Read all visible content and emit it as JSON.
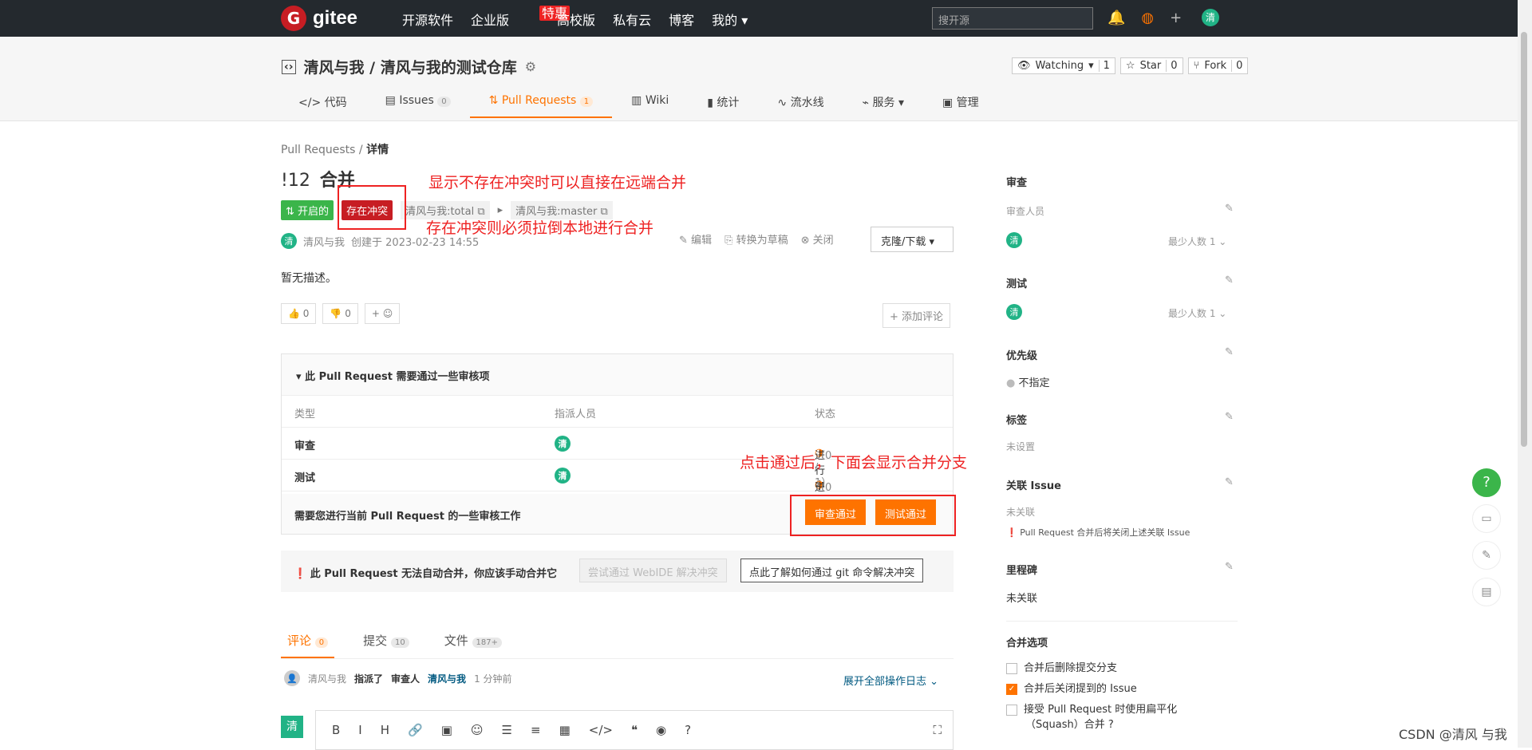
{
  "nav": {
    "logo": "gitee",
    "items": [
      "开源软件",
      "企业版",
      "高校版",
      "私有云",
      "博客",
      "我的"
    ],
    "hot": "特惠",
    "search_placeholder": "搜开源",
    "user_avatar": "清"
  },
  "repo": {
    "title": "清风与我 / 清风与我的测试仓库",
    "watching": "Watching",
    "watch_count": "1",
    "star": "Star",
    "star_count": "0",
    "fork": "Fork",
    "fork_count": "0",
    "tabs": [
      {
        "label": "代码"
      },
      {
        "label": "Issues",
        "count": "0"
      },
      {
        "label": "Pull Requests",
        "count": "1"
      },
      {
        "label": "Wiki"
      },
      {
        "label": "统计"
      },
      {
        "label": "流水线"
      },
      {
        "label": "服务"
      },
      {
        "label": "管理"
      }
    ]
  },
  "pr": {
    "breadcrumb_root": "Pull Requests",
    "breadcrumb_sep": "/",
    "breadcrumb_cur": "详情",
    "number": "!12",
    "title": "合并",
    "status": "开启的",
    "conflict": "存在冲突",
    "source": "清风与我:total",
    "target": "清风与我:master",
    "author": "清风与我",
    "created": "创建于 2023-02-23 14:55",
    "actions": [
      "编辑",
      "转换为草稿",
      "关闭"
    ],
    "clone": "克隆/下载",
    "description": "暂无描述。",
    "thumbs_up": "0",
    "thumbs_down": "0",
    "add_react": "+ ☺",
    "add_comment": "+ 添加评论"
  },
  "review": {
    "header": "此 Pull Request 需要通过一些审核项",
    "cols": [
      "类型",
      "指派人员",
      "状态"
    ],
    "rows": [
      {
        "type": "审查",
        "assignee": "清",
        "status": "进行中",
        "progress": "（0 / 1）"
      },
      {
        "type": "测试",
        "assignee": "清",
        "status": "进行中",
        "progress": "（0 / 1）"
      }
    ],
    "footer": "需要您进行当前 Pull Request 的一些审核工作",
    "btn_review": "审查通过",
    "btn_test": "测试通过"
  },
  "warn": {
    "text": "此 Pull Request 无法自动合并，你应该手动合并它",
    "btn_webide": "尝试通过 WebIDE 解决冲突",
    "btn_git": "点此了解如何通过 git 命令解决冲突"
  },
  "ctabs": [
    {
      "label": "评论",
      "count": "0"
    },
    {
      "label": "提交",
      "count": "10"
    },
    {
      "label": "文件",
      "count": "187+"
    }
  ],
  "log": {
    "user": "清风与我",
    "action": "指派了",
    "role": "审查人",
    "target": "清风与我",
    "time": "1 分钟前",
    "expand": "展开全部操作日志"
  },
  "editor": {
    "avatar": "清",
    "tools": [
      "B",
      "I",
      "H",
      "🔗",
      "▣",
      "☺",
      "☰",
      "≡",
      "▦",
      "</>",
      "❝",
      "◉",
      "?"
    ],
    "fullscreen": "⛶"
  },
  "side": {
    "review_title": "审查",
    "reviewer_label": "审查人员",
    "reviewer_min": "最少人数 1",
    "test_title": "测试",
    "test_min": "最少人数 1",
    "priority_title": "优先级",
    "priority_val": "不指定",
    "label_title": "标签",
    "label_val": "未设置",
    "issue_title": "关联 Issue",
    "issue_val": "未关联",
    "issue_note": "Pull Request 合并后将关闭上述关联 Issue",
    "milestone_title": "里程碑",
    "milestone_val": "未关联",
    "merge_title": "合并选项",
    "opt1": "合并后删除提交分支",
    "opt2": "合并后关闭提到的 Issue",
    "opt3": "接受 Pull Request 时使用扁平化",
    "opt3b": "（Squash）合并"
  },
  "annotations": {
    "a1": "显示不存在冲突时可以直接在远端合并",
    "a2": "存在冲突则必须拉倒本地进行合并",
    "a3": "点击通过后，下面会显示合并分支"
  },
  "watermark": "CSDN @清风 与我"
}
